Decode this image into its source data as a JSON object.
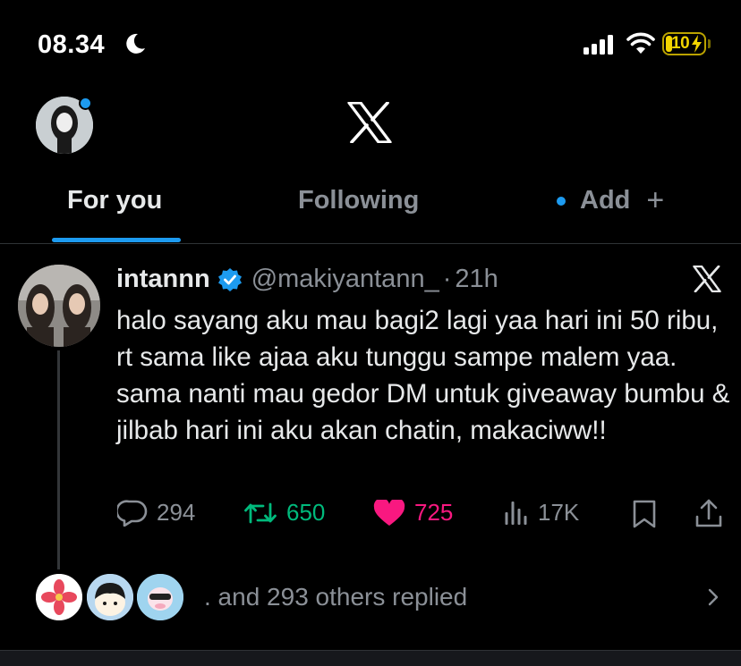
{
  "status_bar": {
    "time": "08.34",
    "battery": "10"
  },
  "tabs": [
    {
      "label": "For you"
    },
    {
      "label": "Following"
    },
    {
      "label": "Add"
    }
  ],
  "tweet": {
    "author_name": "intannn",
    "handle": "@makiyantann_",
    "separator": "·",
    "time": "21h",
    "text": "halo sayang aku mau bagi2 lagi yaa hari ini 50 ribu, rt sama like ajaa aku tunggu sampe malem yaa. sama nanti mau gedor DM untuk giveaway bumbu & jilbab hari ini aku akan chatin, makaciww!!",
    "replies": "294",
    "retweets": "650",
    "likes": "725",
    "views": "17K"
  },
  "replies_preview": {
    "text": ". and 293 others replied"
  },
  "colors": {
    "accent": "#1d9bf0",
    "retweet": "#00ba7c",
    "like": "#f91880",
    "muted": "#8b9097"
  }
}
